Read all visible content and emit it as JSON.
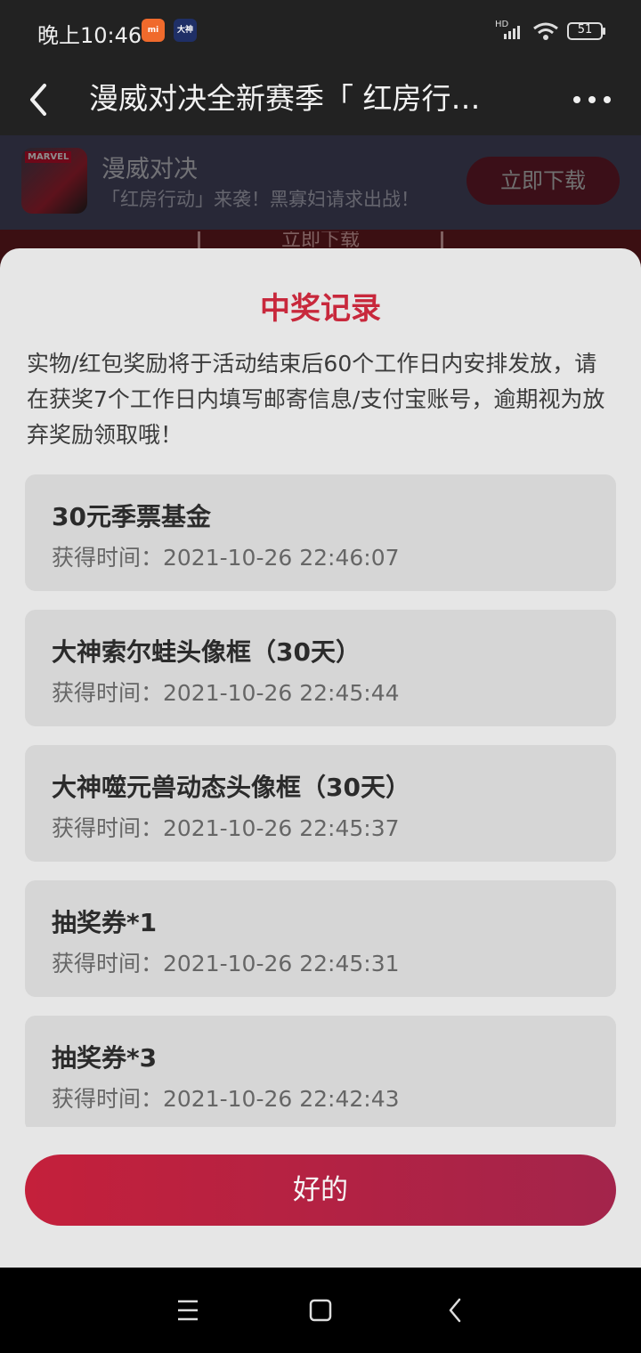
{
  "status_bar": {
    "time": "晚上10:46",
    "app_icons": [
      {
        "name": "mi-icon",
        "text": "mi"
      },
      {
        "name": "dashen-app-icon",
        "text": "大神"
      }
    ],
    "network_label": "HD",
    "battery": "51"
  },
  "header": {
    "title": "漫威对决全新赛季「 红房行…",
    "back_icon": "chevron-left-icon",
    "more_icon": "more-horizontal-icon"
  },
  "banner": {
    "icon_label": "MARVEL",
    "app_name": "漫威对决",
    "description": "「红房行动」来袭！黑寡妇请求出战！",
    "download_label": "立即下载"
  },
  "behind_page_text": "立即下载",
  "dialog": {
    "title": "中奖记录",
    "notice": "实物/红包奖励将于活动结束后60个工作日内安排发放，请在获奖7个工作日内填写邮寄信息/支付宝账号，逾期视为放弃奖励领取哦！",
    "records": [
      {
        "name": "30元季票基金",
        "time": "获得时间：2021-10-26 22:46:07"
      },
      {
        "name": "大神索尔蛙头像框（30天）",
        "time": "获得时间：2021-10-26 22:45:44"
      },
      {
        "name": "大神噬元兽动态头像框（30天）",
        "time": "获得时间：2021-10-26 22:45:37"
      },
      {
        "name": "抽奖券*1",
        "time": "获得时间：2021-10-26 22:45:31"
      },
      {
        "name": "抽奖券*3",
        "time": "获得时间：2021-10-26 22:42:43"
      }
    ],
    "ok_label": "好的"
  },
  "nav_bar": {
    "icons": [
      "menu-icon",
      "home-icon",
      "back-icon"
    ]
  },
  "colors": {
    "accent": "#c8283c",
    "sheet_bg": "#e6e6e6",
    "card_bg": "#d6d6d6"
  }
}
